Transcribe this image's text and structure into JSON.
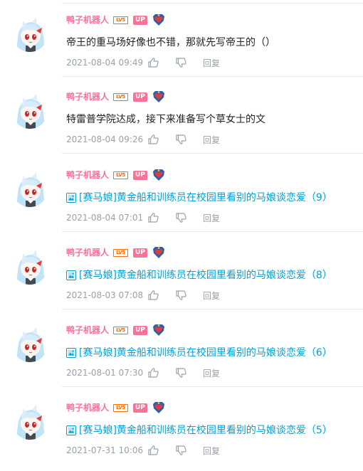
{
  "colors": {
    "username": "#fb7299",
    "up_badge": "#fb7299",
    "level_badge": "#ff6c00",
    "link": "#00a1d6",
    "meta": "#99a2aa",
    "divider": "#e5e9ef"
  },
  "icons": {
    "like": "thumbs-up-icon",
    "dislike": "thumbs-down-icon",
    "level": "level-badge-icon",
    "medal": "heart-medal-icon",
    "article": "article-doc-icon"
  },
  "comments": [
    {
      "username": "鸭子机器人",
      "level": "LV5",
      "up": "UP",
      "text": "帝王的重马场好像也不错，那就先写帝王的（）",
      "time": "2021-08-04 09:49",
      "reply": "回复"
    },
    {
      "username": "鸭子机器人",
      "level": "LV5",
      "up": "UP",
      "text": "特雷普学院达成，接下来准备写个草女士的文",
      "time": "2021-08-04 09:26",
      "reply": "回复"
    },
    {
      "username": "鸭子机器人",
      "level": "LV5",
      "up": "UP",
      "text": "[赛马娘]黄金船和训练员在校园里看别的马娘谈恋爱（9）",
      "time": "2021-08-04 07:01",
      "reply": "回复"
    },
    {
      "username": "鸭子机器人",
      "level": "LV5",
      "up": "UP",
      "text": "[赛马娘]黄金船和训练员在校园里看别的马娘谈恋爱（8）",
      "time": "2021-08-03 07:08",
      "reply": "回复"
    },
    {
      "username": "鸭子机器人",
      "level": "LV5",
      "up": "UP",
      "text": "[赛马娘]黄金船和训练员在校园里看别的马娘谈恋爱（6）",
      "time": "2021-08-01 07:30",
      "reply": "回复"
    },
    {
      "username": "鸭子机器人",
      "level": "LV5",
      "up": "UP",
      "text": "[赛马娘]黄金船和训练员在校园里看别的马娘谈恋爱（5）",
      "time": "2021-07-31 10:06",
      "reply": "回复"
    }
  ]
}
